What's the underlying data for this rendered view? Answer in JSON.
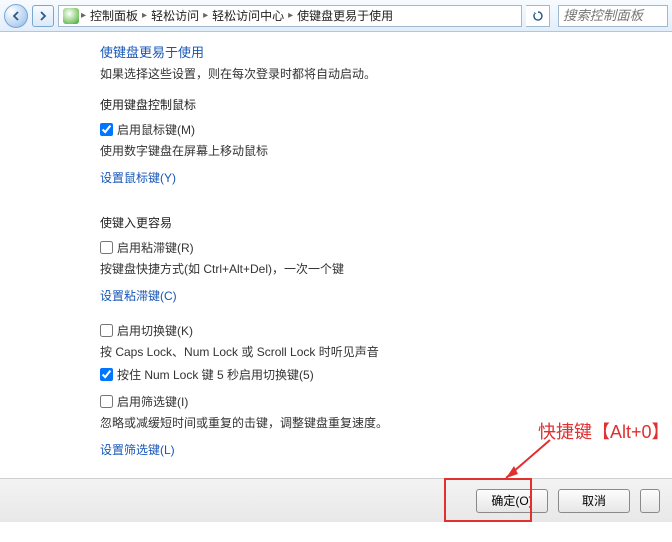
{
  "toolbar": {
    "crumbs": [
      "控制面板",
      "轻松访问",
      "轻松访问中心",
      "使键盘更易于使用"
    ],
    "search_placeholder": "搜索控制面板"
  },
  "page": {
    "truncated_title": "使键盘更易于使用",
    "intro": "如果选择这些设置，则在每次登录时都将自动启动。"
  },
  "section_mouse": {
    "heading": "使用键盘控制鼠标",
    "enable_label": "启用鼠标键(M)",
    "enable_desc": "使用数字键盘在屏幕上移动鼠标",
    "link": "设置鼠标键(Y)"
  },
  "section_easy": {
    "heading": "使键入更容易",
    "sticky_label": "启用粘滞键(R)",
    "sticky_desc": "按键盘快捷方式(如 Ctrl+Alt+Del)，一次一个键",
    "sticky_link": "设置粘滞键(C)",
    "toggle_label": "启用切换键(K)",
    "toggle_desc": "按 Caps Lock、Num Lock 或 Scroll Lock 时听见声音",
    "toggle_hold_label": "按住 Num Lock 键 5 秒启用切换键(5)",
    "filter_label": "启用筛选键(I)",
    "filter_desc": "忽略或减缓短时间或重复的击键，调整键盘重复速度。",
    "filter_link": "设置筛选键(L)"
  },
  "buttons": {
    "ok": "确定(O)",
    "cancel": "取消"
  },
  "annotation": {
    "text": "快捷键【Alt+0】"
  }
}
